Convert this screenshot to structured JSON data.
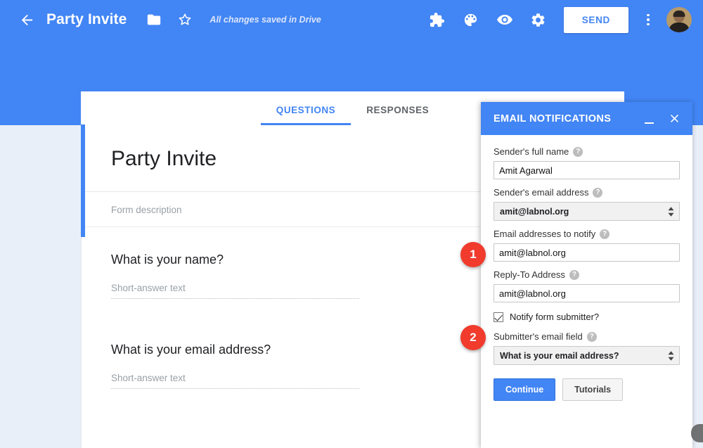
{
  "header": {
    "back_icon": "back-arrow-icon",
    "form_title": "Party Invite",
    "folder_icon": "folder-icon",
    "star_icon": "star-outline-icon",
    "save_status": "All changes saved in Drive",
    "addons_icon": "puzzle-piece-icon",
    "theme_icon": "palette-icon",
    "preview_icon": "eye-icon",
    "settings_icon": "gear-icon",
    "send_label": "SEND",
    "more_icon": "vertical-dots-icon",
    "avatar_alt": "user-avatar"
  },
  "tabs": [
    {
      "label": "QUESTIONS",
      "active": true
    },
    {
      "label": "RESPONSES",
      "active": false
    }
  ],
  "form": {
    "title": "Party Invite",
    "description_placeholder": "Form description",
    "questions": [
      {
        "title": "What is your name?",
        "answer_placeholder": "Short-answer text"
      },
      {
        "title": "What is your email address?",
        "answer_placeholder": "Short-answer text"
      }
    ]
  },
  "dialog": {
    "title": "EMAIL NOTIFICATIONS",
    "minimize_icon": "minimize-icon",
    "close_icon": "close-x-icon",
    "help_glyph": "?",
    "fields": [
      {
        "label": "Sender's full name",
        "value": "Amit Agarwal",
        "type": "text"
      },
      {
        "label": "Sender's email address",
        "value": "amit@labnol.org",
        "type": "select"
      },
      {
        "label": "Email addresses to notify",
        "value": "amit@labnol.org",
        "type": "text"
      },
      {
        "label": "Reply-To Address",
        "value": "amit@labnol.org",
        "type": "text"
      }
    ],
    "checkbox": {
      "label": "Notify form submitter?",
      "checked": true
    },
    "submitter_field": {
      "label": "Submitter's email field",
      "value": "What is your email address?"
    },
    "continue_label": "Continue",
    "tutorials_label": "Tutorials"
  },
  "annotations": [
    {
      "number": "1"
    },
    {
      "number": "2"
    }
  ],
  "colors": {
    "brand_blue": "#4285f4",
    "page_bg": "#e9eff9",
    "badge_red": "#f03b2d"
  }
}
